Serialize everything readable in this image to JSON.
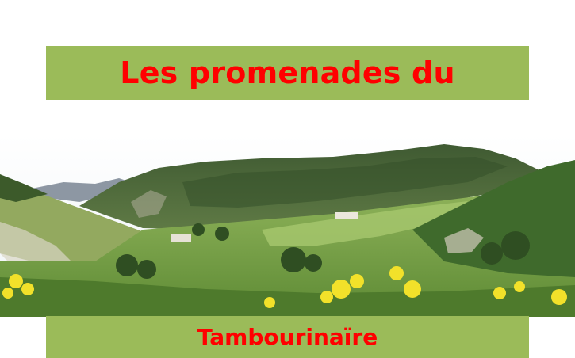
{
  "header": {
    "title": "Les promenades du"
  },
  "footer": {
    "subtitle": "Tambourinaïre"
  },
  "photo": {
    "subject": "landscape-photo"
  },
  "colors": {
    "band": "#9bbb59",
    "title_text": "#ff0000",
    "page_background": "#ffffff"
  }
}
